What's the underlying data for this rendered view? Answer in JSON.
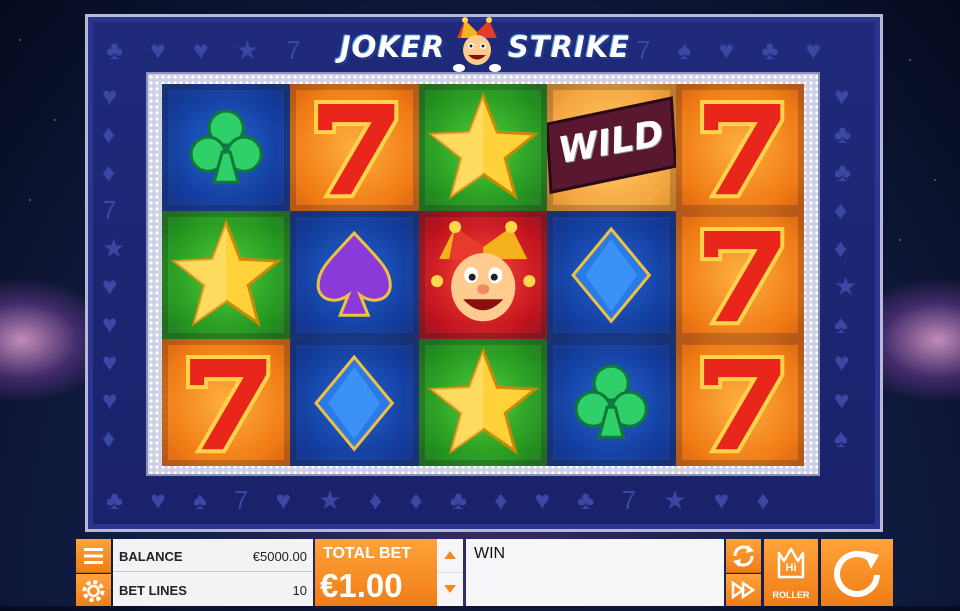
{
  "game": {
    "logo_left": "JOKER",
    "logo_right": "STRIKE"
  },
  "reels": [
    [
      "club-symbol",
      "seven-symbol",
      "star-symbol",
      "wild-symbol",
      "seven-symbol"
    ],
    [
      "star-symbol",
      "spade-symbol",
      "joker-symbol",
      "diamond-symbol",
      "seven-symbol"
    ],
    [
      "seven-symbol",
      "diamond-symbol",
      "star-symbol",
      "club-symbol",
      "seven-symbol"
    ]
  ],
  "wild_label": "WILD",
  "controls": {
    "balance_label": "BALANCE",
    "balance_value": "€5000.00",
    "bet_lines_label": "BET LINES",
    "bet_lines_value": "10",
    "total_bet_label": "TOTAL BET",
    "total_bet_value": "€1.00",
    "win_label": "WIN",
    "hiroller_badge": "Hi",
    "hiroller_label": "ROLLER"
  },
  "colors": {
    "accent_orange": "#f5881e",
    "frame_blue": "#1f2a7c"
  }
}
